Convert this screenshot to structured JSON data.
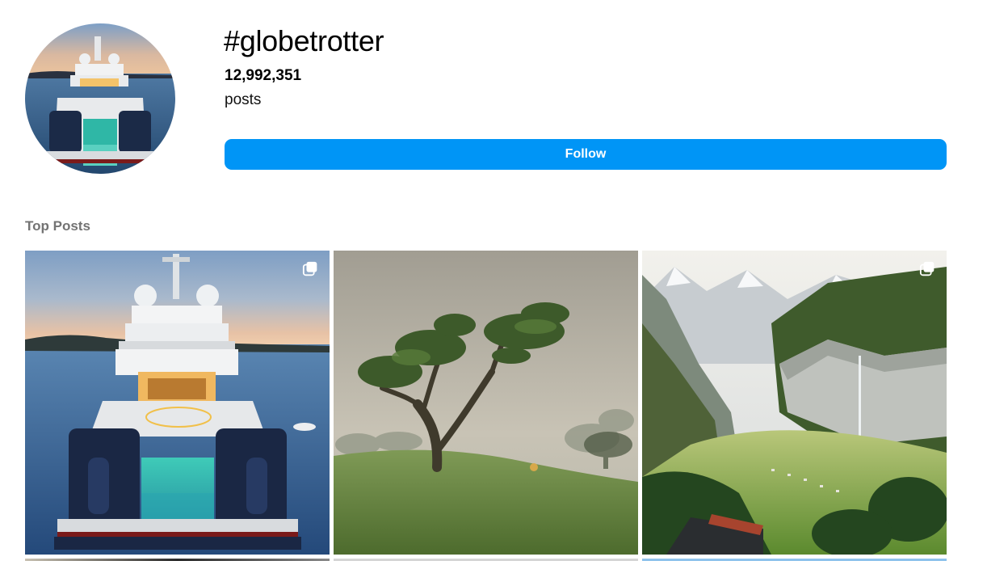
{
  "header": {
    "hashtag": "#globetrotter",
    "post_count": "12,992,351",
    "post_unit": "posts",
    "follow_label": "Follow",
    "accent_color": "#0095f6"
  },
  "top_posts": {
    "label": "Top Posts",
    "items": [
      {
        "subject": "superyacht at sea",
        "multi_image": true,
        "icon": "carousel-icon"
      },
      {
        "subject": "lone tree in fog",
        "multi_image": false
      },
      {
        "subject": "alpine valley with waterfall",
        "multi_image": true,
        "icon": "carousel-icon"
      }
    ]
  }
}
